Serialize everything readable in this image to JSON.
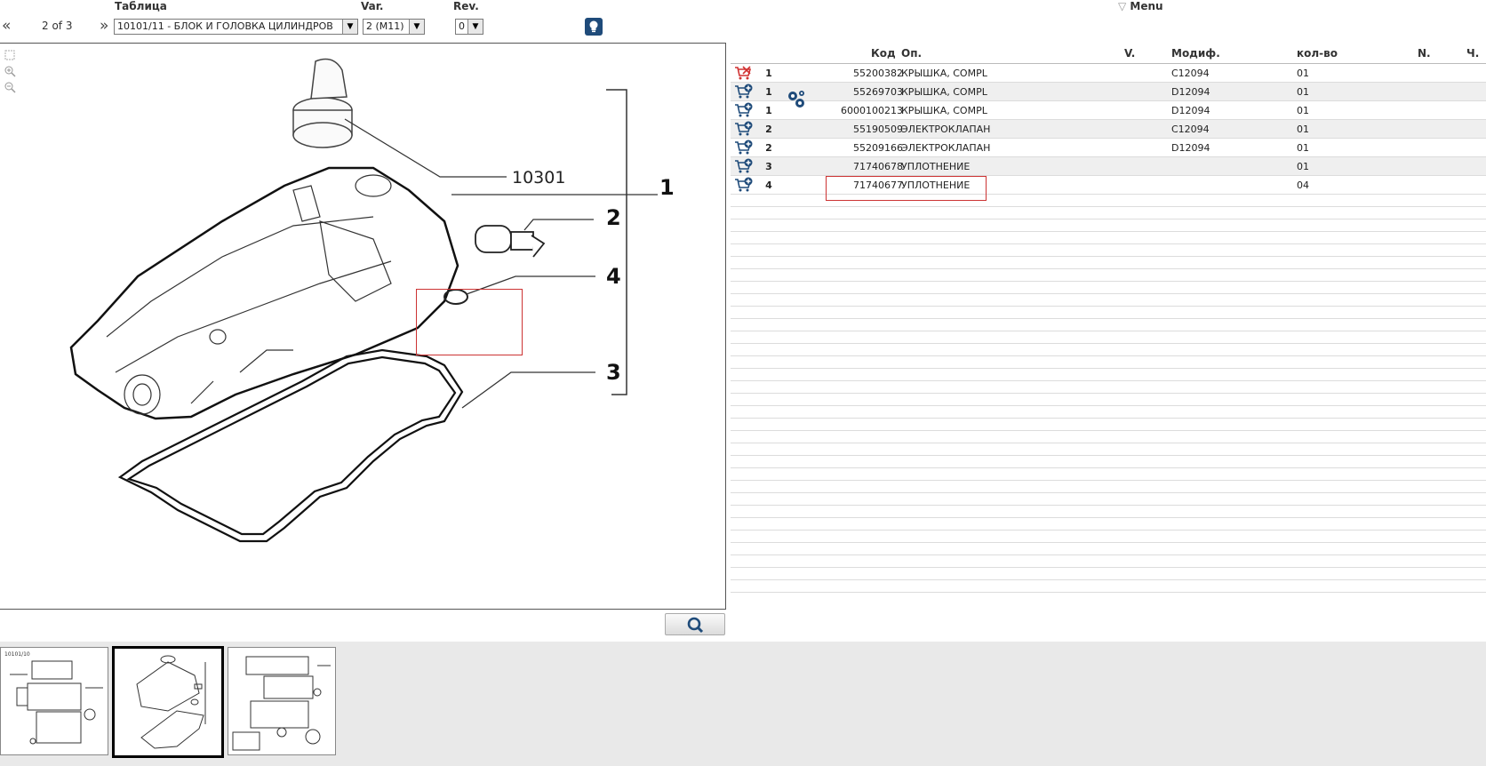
{
  "header": {
    "table_label": "Таблица",
    "var_label": "Var.",
    "rev_label": "Rev.",
    "pager": "2 of 3",
    "prev_icon": "«",
    "next_icon": "»",
    "table_value": "10101/11 - БЛОК И ГОЛОВКА ЦИЛИНДРОВ",
    "var_value": "2 (M11)",
    "rev_value": "0",
    "menu_label": "Menu",
    "menu_icon": "▽"
  },
  "drawing": {
    "callouts": {
      "c10301": "10301",
      "c1": "1",
      "c2": "2",
      "c4": "4",
      "c3": "3"
    }
  },
  "table": {
    "headers": {
      "code": "Код",
      "op": "Оп.",
      "v": "V.",
      "modif": "Модиф.",
      "qty": "кол-во",
      "n": "N.",
      "ch": "Ч."
    },
    "rows": [
      {
        "pos": "1",
        "code": "55200382",
        "desc": "КРЫШКА, COMPL",
        "modif": "C12094",
        "qty": "01"
      },
      {
        "pos": "1",
        "code": "55269703",
        "desc": "КРЫШКА, COMPL",
        "modif": "D12094",
        "qty": "01"
      },
      {
        "pos": "1",
        "code": "6000100213",
        "desc": "КРЫШКА, COMPL",
        "modif": "D12094",
        "qty": "01"
      },
      {
        "pos": "2",
        "code": "55190509",
        "desc": "ЭЛЕКТРОКЛАПАН",
        "modif": "C12094",
        "qty": "01"
      },
      {
        "pos": "2",
        "code": "55209166",
        "desc": "ЭЛЕКТРОКЛАПАН",
        "modif": "D12094",
        "qty": "01"
      },
      {
        "pos": "3",
        "code": "71740678",
        "desc": "УПЛОТНЕНИЕ",
        "modif": "",
        "qty": "01"
      },
      {
        "pos": "4",
        "code": "71740677",
        "desc": "УПЛОТНЕНИЕ",
        "modif": "",
        "qty": "04"
      }
    ]
  },
  "thumbnails": {
    "t1_label": "10101/10"
  },
  "colors": {
    "accent": "#1f4b7a",
    "highlight": "#cc3333",
    "cart_red": "#d03030",
    "row_alt": "#efefef"
  }
}
